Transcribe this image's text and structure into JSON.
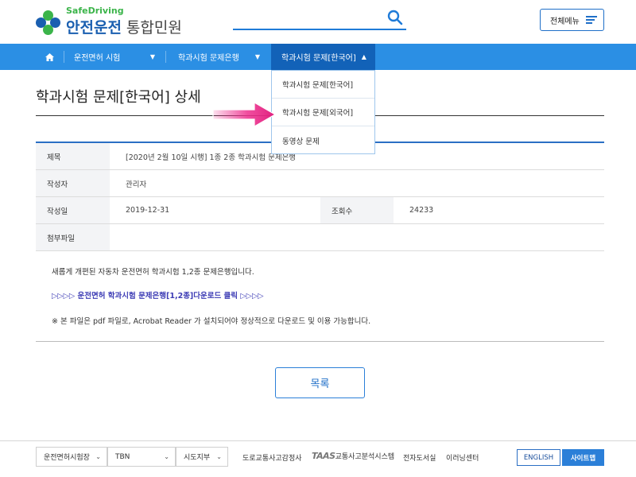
{
  "header": {
    "logo_en": "SafeDriving",
    "logo_main": "안전운전",
    "logo_sub": "통합민원",
    "all_menu": "전체메뉴"
  },
  "nav": {
    "items": [
      {
        "label": "운전면허 시험"
      },
      {
        "label": "학과시험 문제은행"
      },
      {
        "label": "학과시험 문제[한국어]"
      }
    ]
  },
  "dropdown": {
    "items": [
      {
        "label": "학과시험 문제[한국어]"
      },
      {
        "label": "학과시험 문제[외국어]"
      },
      {
        "label": "동영상 문제"
      }
    ]
  },
  "page": {
    "title": "학과시험 문제[한국어] 상세"
  },
  "post": {
    "subject_label": "제목",
    "subject": "[2020년 2월 10일 시행] 1종 2종 학과시험 문제은행",
    "author_label": "작성자",
    "author": "관리자",
    "date_label": "작성일",
    "date": "2019-12-31",
    "views_label": "조회수",
    "views": "24233",
    "attach_label": "첨부파일",
    "attach": ""
  },
  "content": {
    "line1": "새롭게 개편된 자동차 운전면허 학과시험 1,2종 문제은행입니다.",
    "download_link": "▷▷▷▷ 운전면허 학과시험 문제은행[1,2종]다운로드 클릭 ▷▷▷▷",
    "note": "※ 본 파일은 pdf 파일로, Acrobat Reader 가 설치되어야 정상적으로 다운로드 및 이용 가능합니다."
  },
  "list_button": "목록",
  "footer": {
    "select1": "운전면허시험장",
    "select2": "TBN",
    "select3": "시도지부",
    "links": [
      "도로교통사고감정사",
      "교통사고분석시스템",
      "전자도서실",
      "이러닝센터"
    ],
    "taas": "TAAS",
    "english": "ENGLISH",
    "sitemap": "사이트맵"
  },
  "colors": {
    "nav_bg": "#2b8fe4",
    "nav_active": "#1262b8",
    "accent": "#2b7fd8",
    "link": "#3d3cb5",
    "arrow": "#ee2f8e"
  }
}
